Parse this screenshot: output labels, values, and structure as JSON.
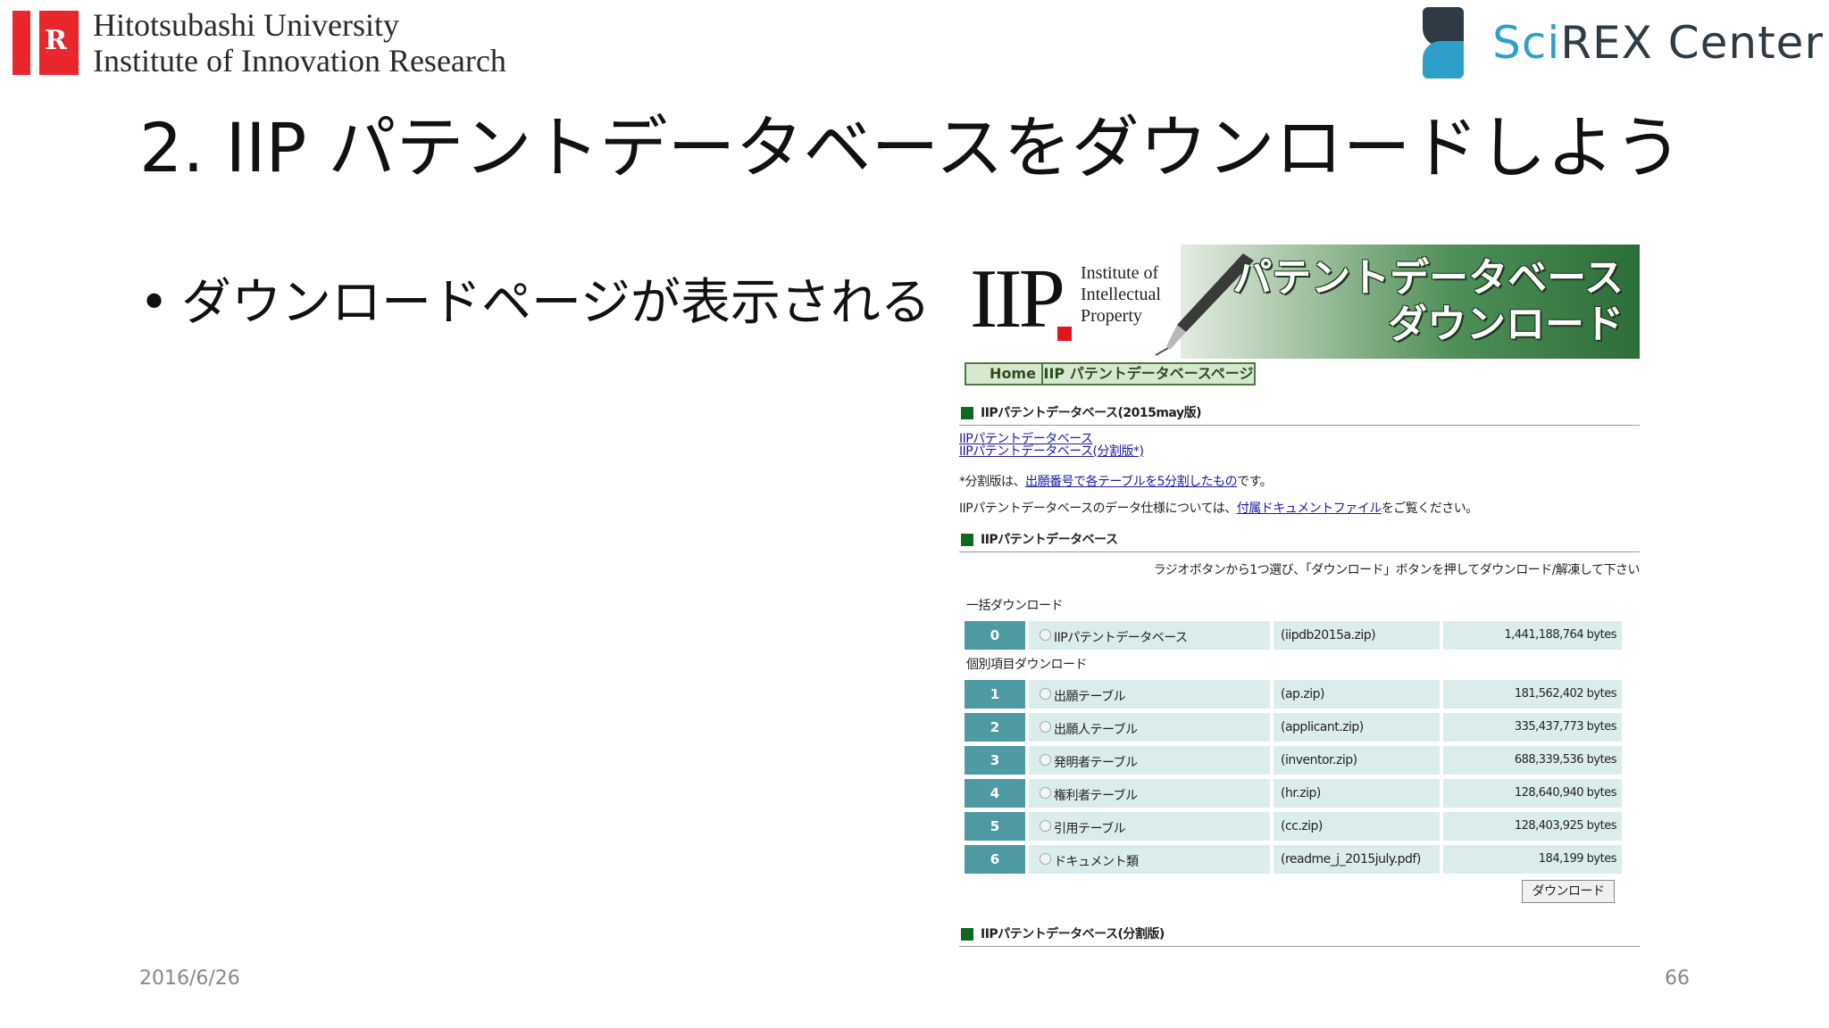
{
  "header": {
    "iir_line1": "Hitotsubashi University",
    "iir_line2": "Institute of Innovation Research",
    "iir_logo_letter": "R",
    "scirex_prefix": "Sci",
    "scirex_rest": "REX Center",
    "brand_red": "#e8262b",
    "brand_blue": "#2e9fc9"
  },
  "slide": {
    "title": "2. IIP パテントデータベースをダウンロードしよう",
    "bullet": "ダウンロードページが表示される",
    "date": "2016/6/26",
    "page": "66"
  },
  "webpage": {
    "logo_text": "IIP",
    "logo_sub": [
      "Institute of",
      "Intellectual",
      "Property"
    ],
    "banner_title_1": "パテントデータベース",
    "banner_title_2": "ダウンロード",
    "nav_home": "Home",
    "nav_iip": "IIP パテントデータベースページ",
    "section1": "IIPパテントデータベース(2015may版)",
    "link1": "IIPパテントデータベース",
    "link2": "IIPパテントデータベース(分割版*)",
    "note_prefix": "*分割版は、",
    "note_link": "出願番号で各テーブルを5分割したもの",
    "note_suffix": "です。",
    "spec_prefix": "IIPパテントデータベースのデータ仕様については、",
    "spec_link": "付属ドキュメントファイル",
    "spec_suffix": "をご覧ください。",
    "section2": "IIPパテントデータベース",
    "instruction": "ラジオボタンから1つ選び、「ダウンロード」ボタンを押してダウンロード/解凍して下さい",
    "bulk_label": "一括ダウンロード",
    "individual_label": "個別項目ダウンロード",
    "rows": [
      {
        "num": "0",
        "name": "IIPパテントデータベース",
        "file": "(iipdb2015a.zip)",
        "size": "1,441,188,764 bytes"
      },
      {
        "num": "1",
        "name": "出願テーブル",
        "file": "(ap.zip)",
        "size": "181,562,402 bytes"
      },
      {
        "num": "2",
        "name": "出願人テーブル",
        "file": "(applicant.zip)",
        "size": "335,437,773 bytes"
      },
      {
        "num": "3",
        "name": "発明者テーブル",
        "file": "(inventor.zip)",
        "size": "688,339,536 bytes"
      },
      {
        "num": "4",
        "name": "権利者テーブル",
        "file": "(hr.zip)",
        "size": "128,640,940 bytes"
      },
      {
        "num": "5",
        "name": "引用テーブル",
        "file": "(cc.zip)",
        "size": "128,403,925 bytes"
      },
      {
        "num": "6",
        "name": "ドキュメント類",
        "file": "(readme_j_2015july.pdf)",
        "size": "184,199 bytes"
      }
    ],
    "download_button": "ダウンロード",
    "section3": "IIPパテントデータベース(分割版)",
    "accent_green": "#0e6b1e",
    "row_teal": "#4d9aa3"
  }
}
